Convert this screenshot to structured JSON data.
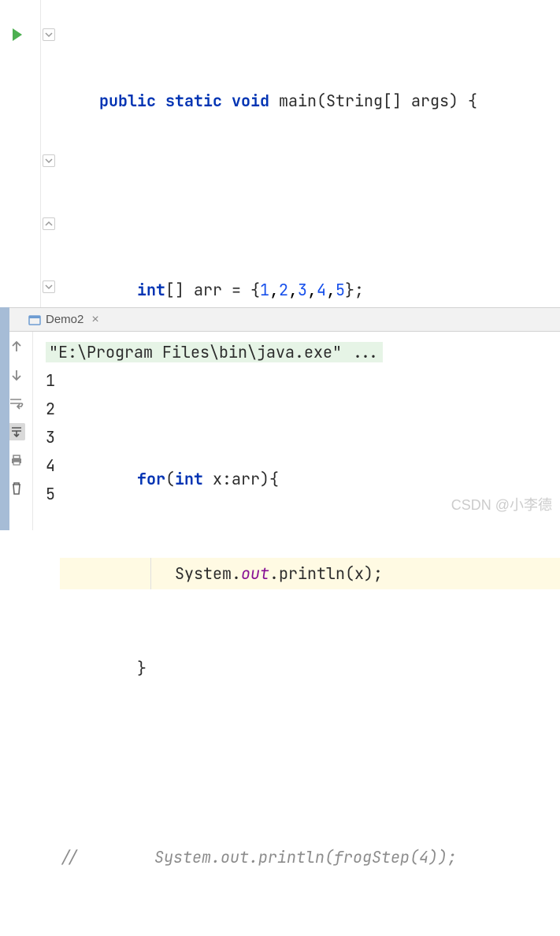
{
  "code": {
    "line1": {
      "kw1": "public",
      "kw2": "static",
      "kw3": "void",
      "sig": " main(String[] args) {"
    },
    "line2_kw": "int",
    "line2_a": "[] arr = {",
    "line2_nums": [
      "1",
      "2",
      "3",
      "4",
      "5"
    ],
    "line2_end": "};",
    "line3_kw": "for",
    "line3_a": "(",
    "line3_kw2": "int",
    "line3_b": " x:arr){",
    "line4_a": "System.",
    "line4_field": "out",
    "line4_b": ".println(x);",
    "line5": "}",
    "comment": "//        System.out.println(frogStep(4));"
  },
  "tool": {
    "tab_label": "Demo2",
    "cmd": "\"E:\\Program Files\\bin\\java.exe\" ...",
    "output": [
      "1",
      "2",
      "3",
      "4",
      "5"
    ]
  },
  "watermark": "CSDN @小李德"
}
